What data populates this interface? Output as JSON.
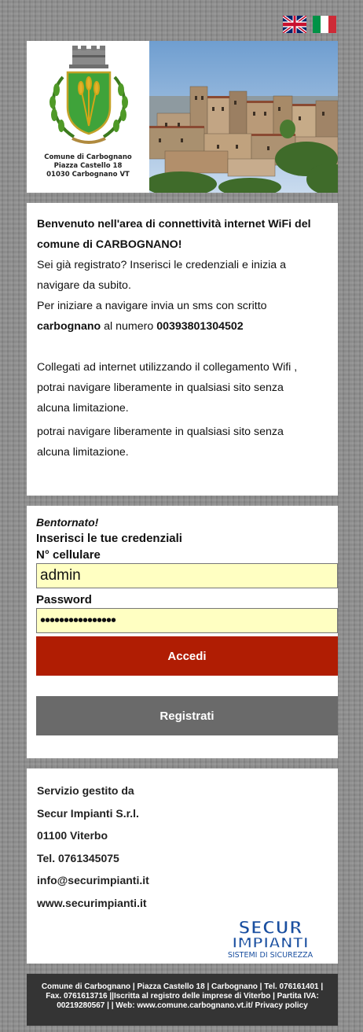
{
  "languages": [
    {
      "label": "English",
      "icon": "uk-flag-icon"
    },
    {
      "label": "Italiano",
      "icon": "italy-flag-icon"
    }
  ],
  "header": {
    "caption_lines": [
      "Comune di Carbognano",
      "Piazza Castello 18",
      "01030 Carbognano VT"
    ]
  },
  "welcome": {
    "title_line1": "Benvenuto nell'area di connettività internet WiFi del",
    "title_line2": "comune di CARBOGNANO!",
    "p1_line1": "Sei già registrato? Inserisci le credenziali e inizia a",
    "p1_line2": "navigare da subito.",
    "p2_line1": "Per iniziare a navigare invia un sms con scritto",
    "p2_keyword": "carbognano",
    "p2_mid": " al numero ",
    "p2_number": "00393801304502",
    "p3_line1": "Collegati ad internet utilizzando il collegamento Wifi ,",
    "p3_line2": "potrai navigare liberamente in qualsiasi sito senza",
    "p3_line3": "alcuna limitazione.",
    "p4_line1": "potrai navigare liberamente in qualsiasi sito senza",
    "p4_line2": "alcuna limitazione."
  },
  "login": {
    "greeting": "Bentornato!",
    "instructions": "Inserisci le tue credenziali",
    "phone_label": "N° cellulare",
    "phone_value": "admin",
    "password_label": "Password",
    "password_value": "••••••••••••••••",
    "submit_label": "Accedi",
    "register_label": "Registrati"
  },
  "company": {
    "lines": [
      "Servizio gestito da",
      "Secur Impianti S.r.l.",
      "01100 Viterbo",
      "Tel. 0761345075",
      "info@securimpianti.it",
      "www.securimpianti.it"
    ],
    "logo_word1": "SECUR",
    "logo_word2": "IMPIANTI",
    "logo_tagline": "SISTEMI DI SICUREZZA"
  },
  "footer": {
    "line1": "Comune di Carbognano | Piazza Castello 18 | Carbognano | Tel. 076161401 |",
    "line2": "Fax. 0761613716 ||Iscritta al registro delle imprese di Viterbo | Partita IVA:",
    "line3": "00219280567 | | Web: www.comune.carbognano.vt.it/ Privacy policy"
  },
  "colors": {
    "accent_red": "#b01d03",
    "button_gray": "#6a6a6a",
    "input_bg": "#ffffc2",
    "footer_bg": "#343434",
    "logo_blue": "#1a4fa0"
  }
}
